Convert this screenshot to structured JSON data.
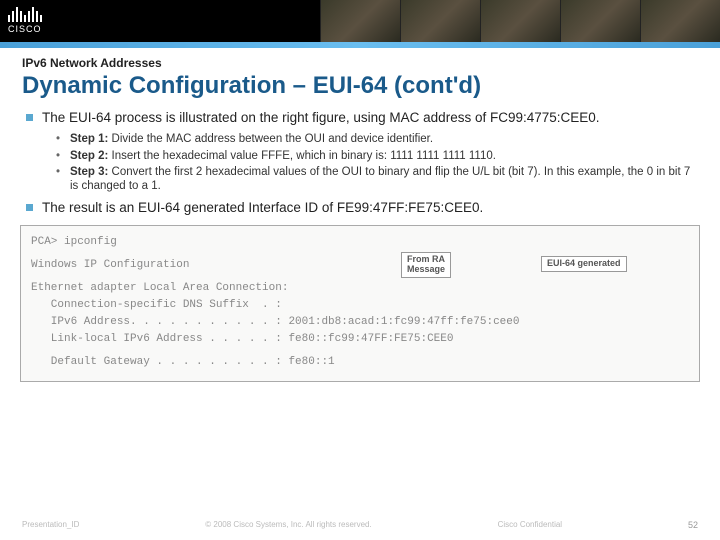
{
  "header": {
    "logo_text": "CISCO"
  },
  "slide": {
    "kicker": "IPv6 Network Addresses",
    "title": "Dynamic Configuration – EUI-64 (cont'd)",
    "bullet1": "The EUI-64 process is illustrated on the right figure, using MAC address of FC99:4775:CEE0.",
    "steps": [
      {
        "label": "Step 1:",
        "text": " Divide the MAC address between the OUI and device identifier."
      },
      {
        "label": "Step 2:",
        "text": " Insert the hexadecimal value FFFE, which in binary is: 1111 1111 1111 1110."
      },
      {
        "label": "Step 3:",
        "text": " Convert the first 2 hexadecimal values of the OUI to binary and flip the U/L bit (bit 7). In this example, the 0 in bit 7 is changed to a 1."
      }
    ],
    "bullet2": "The result is an EUI-64 generated Interface ID of FE99:47FF:FE75:CEE0."
  },
  "terminal": {
    "line0": "PCA> ipconfig",
    "line1": "Windows IP Configuration",
    "line2": "Ethernet adapter Local Area Connection:",
    "line3": "   Connection-specific DNS Suffix  . :",
    "line4": "   IPv6 Address. . . . . . . . . . . : 2001:db8:acad:1:fc99:47ff:fe75:cee0",
    "line5": "   Link-local IPv6 Address . . . . . : fe80::fc99:47FF:FE75:CEE0",
    "line6": "   Default Gateway . . . . . . . . . : fe80::1",
    "callout_ra": "From RA\nMessage",
    "callout_eui": "EUI-64 generated"
  },
  "footer": {
    "left": "Presentation_ID",
    "center": "© 2008 Cisco Systems, Inc. All rights reserved.",
    "right": "Cisco Confidential",
    "page": "52"
  }
}
